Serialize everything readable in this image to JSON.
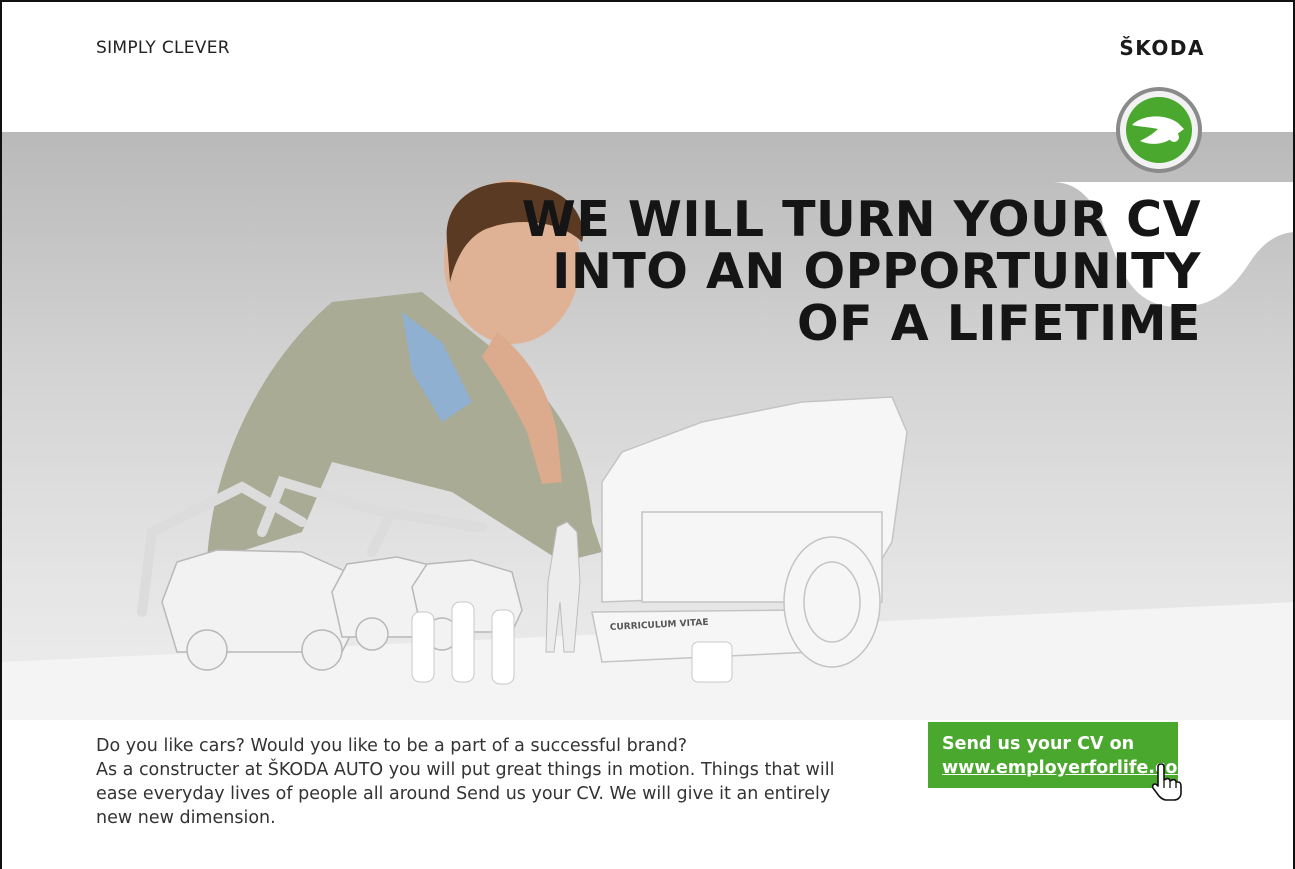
{
  "header": {
    "tagline": "SIMPLY CLEVER",
    "brand": "ŠKODA"
  },
  "headline": {
    "lines": [
      "WE WILL TURN YOUR CV",
      "INTO AN OPPORTUNITY",
      "OF A LIFETIME"
    ]
  },
  "hero": {
    "document_label": "CURRICULUM VITAE"
  },
  "body": {
    "lines": [
      "Do you like cars? Would you like to be a part of a successful brand?",
      "As a constructer at ŠKODA AUTO you will put great things in motion. Things that will",
      "ease everyday lives of people all around Send us your CV. We will give it an entirely",
      "new new dimension."
    ]
  },
  "cta": {
    "line1": "Send us your CV on",
    "url_text": "www.employerforlife.com"
  },
  "colors": {
    "brand_green": "#4ba82e",
    "hero_gray": "#d3d3d3",
    "text_dark": "#151515"
  },
  "icons": [
    "skoda-logo-icon",
    "hand-cursor-icon"
  ]
}
